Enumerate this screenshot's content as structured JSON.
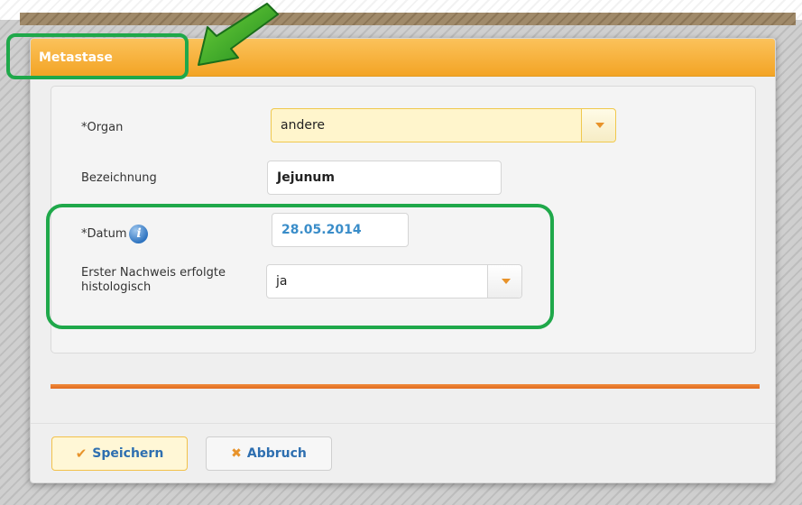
{
  "dialog": {
    "title": "Metastase"
  },
  "form": {
    "organ": {
      "label": "*Organ",
      "value": "andere"
    },
    "bezeichnung": {
      "label": "Bezeichnung",
      "value": "Jejunum"
    },
    "datum": {
      "label": "*Datum",
      "value": "28.05.2014",
      "info_icon": "info-icon"
    },
    "erster_nachweis": {
      "label": "Erster Nachweis erfolgte histologisch",
      "value": "ja"
    }
  },
  "buttons": {
    "save_label": "Speichern",
    "cancel_label": "Abbruch"
  },
  "colors": {
    "titlebar": "#f3a425",
    "highlight": "#1fa84a",
    "accent_orange": "#e8932a",
    "date_value": "#3a8dc9"
  }
}
